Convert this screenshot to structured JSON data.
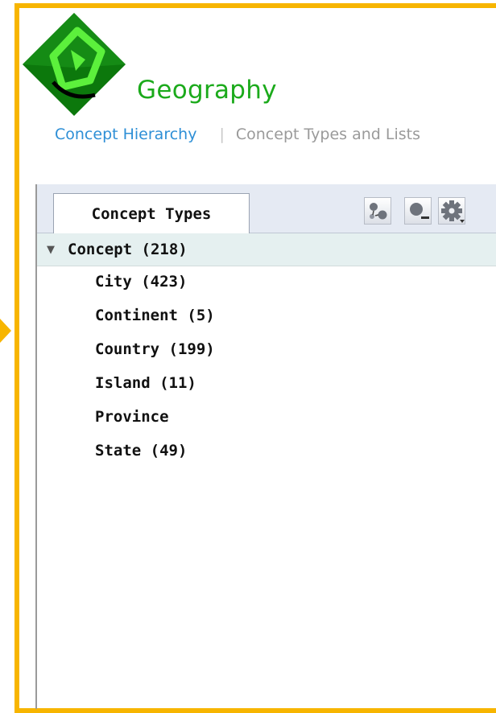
{
  "app": {
    "title": "Geography",
    "accent_color": "#1BAA1B",
    "frame_color": "#F7B500"
  },
  "nav": {
    "items": [
      {
        "label": "Concept Hierarchy",
        "active": true
      },
      {
        "label": "Concept Types and Lists",
        "active": false
      }
    ],
    "separator": "|"
  },
  "panel": {
    "tab_label": "Concept Types",
    "toolbar_icons": [
      "relations-icon",
      "remove-item-icon",
      "gear-dropdown-icon"
    ]
  },
  "tree": {
    "root": {
      "label": "Concept",
      "count": "(218)",
      "expander": "▼",
      "expanded": true
    },
    "children": [
      {
        "label": "City",
        "count": "(423)"
      },
      {
        "label": "Continent",
        "count": "(5)"
      },
      {
        "label": "Country",
        "count": "(199)"
      },
      {
        "label": "Island",
        "count": "(11)"
      },
      {
        "label": "Province",
        "count": ""
      },
      {
        "label": "State",
        "count": "(49)"
      }
    ]
  }
}
